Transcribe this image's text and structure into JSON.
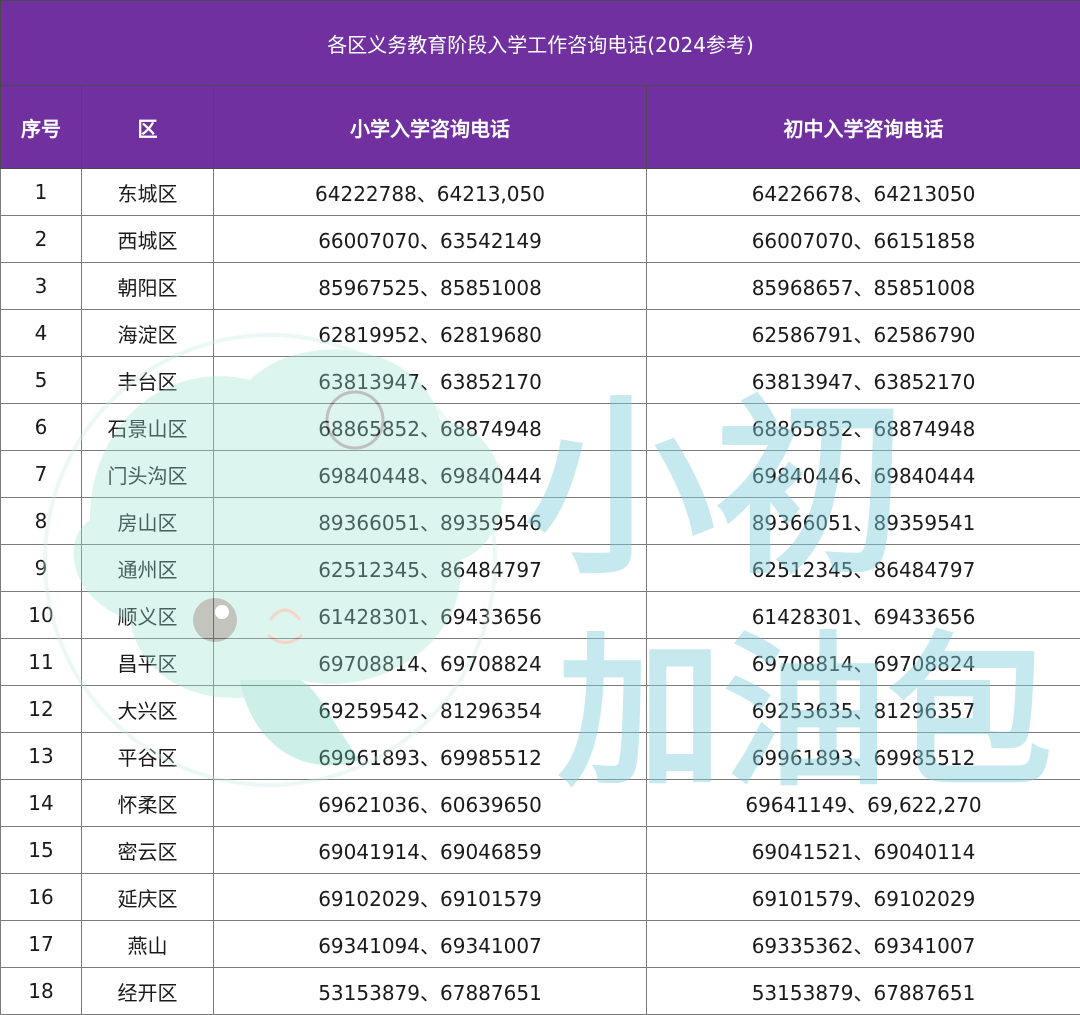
{
  "title": "各区义务教育阶段入学工作咨询电话(2024参考)",
  "headers": {
    "no": "序号",
    "district": "区",
    "primary": "小学入学咨询电话",
    "junior": "初中入学咨询电话"
  },
  "rows": [
    {
      "no": "1",
      "district": "东城区",
      "primary": "64222788、64213,050",
      "junior": "64226678、64213050"
    },
    {
      "no": "2",
      "district": "西城区",
      "primary": "66007070、63542149",
      "junior": "66007070、66151858"
    },
    {
      "no": "3",
      "district": "朝阳区",
      "primary": "85967525、85851008",
      "junior": "85968657、85851008"
    },
    {
      "no": "4",
      "district": "海淀区",
      "primary": "62819952、62819680",
      "junior": "62586791、62586790"
    },
    {
      "no": "5",
      "district": "丰台区",
      "primary": "63813947、63852170",
      "junior": "63813947、63852170"
    },
    {
      "no": "6",
      "district": "石景山区",
      "primary": "68865852、68874948",
      "junior": "68865852、68874948"
    },
    {
      "no": "7",
      "district": "门头沟区",
      "primary": "69840448、69840444",
      "junior": "69840446、69840444"
    },
    {
      "no": "8",
      "district": "房山区",
      "primary": "89366051、89359546",
      "junior": "89366051、89359541"
    },
    {
      "no": "9",
      "district": "通州区",
      "primary": "62512345、86484797",
      "junior": "62512345、86484797"
    },
    {
      "no": "10",
      "district": "顺义区",
      "primary": "61428301、69433656",
      "junior": "61428301、69433656"
    },
    {
      "no": "11",
      "district": "昌平区",
      "primary": "69708814、69708824",
      "junior": "69708814、69708824"
    },
    {
      "no": "12",
      "district": "大兴区",
      "primary": "69259542、81296354",
      "junior": "69253635、81296357"
    },
    {
      "no": "13",
      "district": "平谷区",
      "primary": "69961893、69985512",
      "junior": "69961893、69985512"
    },
    {
      "no": "14",
      "district": "怀柔区",
      "primary": "69621036、60639650",
      "junior": "69641149、69,622,270"
    },
    {
      "no": "15",
      "district": "密云区",
      "primary": "69041914、69046859",
      "junior": "69041521、69040114"
    },
    {
      "no": "16",
      "district": "延庆区",
      "primary": "69102029、69101579",
      "junior": "69101579、69102029"
    },
    {
      "no": "17",
      "district": "燕山",
      "primary": "69341094、69341007",
      "junior": "69335362、69341007"
    },
    {
      "no": "18",
      "district": "经开区",
      "primary": "53153879、67887651",
      "junior": "53153879、67887651"
    }
  ],
  "watermark": {
    "line1": "小初",
    "line2": "加油包",
    "color": "#7fd0db",
    "mascot": "mascot-icon"
  },
  "colors": {
    "header_bg": "#7030a0",
    "header_text": "#ffffff"
  }
}
